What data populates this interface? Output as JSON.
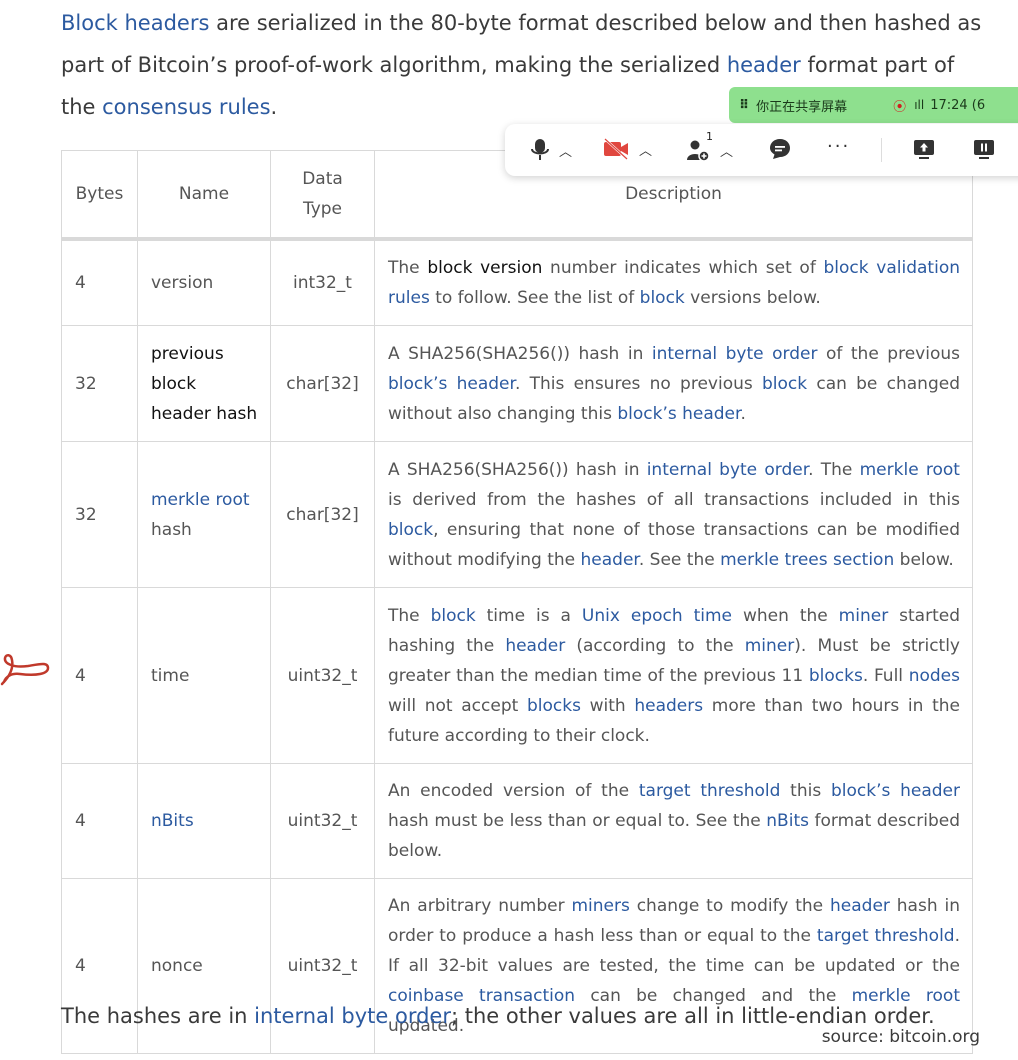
{
  "intro": {
    "p1_link": "Block headers",
    "p1_text": " are serialized in the 80-byte format described below and then hashed as part of Bitcoin’s proof-of-work algorithm, making the serialized ",
    "p1_link2": "header",
    "p1_text2": " format part of the ",
    "p1_link3": "consensus rules",
    "p1_text3": "."
  },
  "table": {
    "headers": [
      "Bytes",
      "Name",
      "Data Type",
      "Description"
    ],
    "header_dtype_line1": "Data",
    "header_dtype_line2": "Type",
    "rows": [
      {
        "bytes": "4",
        "name": "version",
        "dtype": "int32_t"
      },
      {
        "bytes": "32",
        "name_l1": "previous",
        "name_l2": "block",
        "name_l3": "header hash",
        "dtype": "char[32]"
      },
      {
        "bytes": "32",
        "name_link": "merkle root",
        "name_rest": "hash",
        "dtype": "char[32]"
      },
      {
        "bytes": "4",
        "name": "time",
        "dtype": "uint32_t"
      },
      {
        "bytes": "4",
        "name_link": "nBits",
        "dtype": "uint32_t"
      },
      {
        "bytes": "4",
        "name": "nonce",
        "dtype": "uint32_t"
      }
    ],
    "d0": [
      "The ",
      "block version",
      " number indicates which set of ",
      "block validation rules",
      " to follow. See the list of ",
      "block",
      " versions below."
    ],
    "d1": [
      "A SHA256(SHA256()) hash in ",
      "internal byte order",
      " of the previous ",
      "block’s header",
      ". This ensures no previous ",
      "block",
      " can be changed without also changing this ",
      "block’s header",
      "."
    ],
    "d2": [
      "A SHA256(SHA256()) hash in ",
      "internal byte order",
      ". The ",
      "merkle root",
      " is derived from the hashes of all transactions included in this ",
      "block",
      ", ensuring that none of those transactions can be modified without modifying the ",
      "header",
      ". See the ",
      "merkle trees section",
      " below."
    ],
    "d3": [
      "The ",
      "block",
      " time is a ",
      "Unix epoch time",
      " when the ",
      "miner",
      " started hashing the ",
      "header",
      " (according to the ",
      "miner",
      "). Must be strictly greater than the median time of the previous 11 ",
      "blocks",
      ". Full ",
      "nodes",
      " will not accept ",
      "blocks",
      " with ",
      "headers",
      " more than two hours in the future according to their clock."
    ],
    "d4": [
      "An encoded version of the ",
      "target threshold",
      " this ",
      "block’s header",
      " hash must be less than or equal to. See the ",
      "nBits",
      " format described below."
    ],
    "d5": [
      "An arbitrary number ",
      "miners",
      " change to modify the ",
      "header",
      " hash in order to produce a hash less than or equal to the ",
      "target threshold",
      ". If all 32-bit values are tested, the time can be updated or the ",
      "coinbase transaction",
      " can be changed and the ",
      "merkle root",
      " updated."
    ]
  },
  "outro": {
    "text1": "The hashes are in ",
    "link": "internal byte order",
    "text2": "; the other values are all in little-endian order."
  },
  "source": "source: bitcoin.org",
  "share_banner": {
    "text": "你正在共享屏幕",
    "time": "17:24 (6"
  },
  "toolbar": {
    "participants_count": "1"
  },
  "colors": {
    "link": "#2c5aa0",
    "banner": "#8ee08e",
    "pen": "#c0392b"
  }
}
